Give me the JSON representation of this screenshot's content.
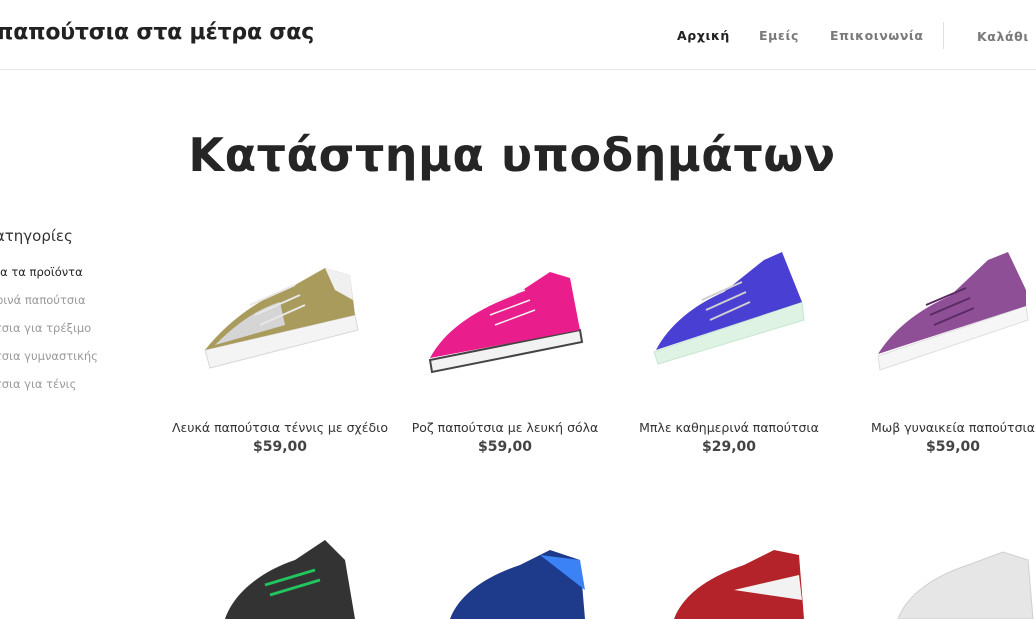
{
  "header": {
    "brand": "παπούτσια στα μέτρα σας",
    "nav": [
      {
        "label": "Αρχική"
      },
      {
        "label": "Εμείς"
      },
      {
        "label": "Επικοινωνία"
      }
    ],
    "cart_label": "Καλάθι"
  },
  "page_title": "Κατάστημα υποδημάτων",
  "sidebar": {
    "heading": "κατηγορίες",
    "items": [
      {
        "label": "Όλα τα προϊόντα"
      },
      {
        "label": "Καθημερινά παπούτσια"
      },
      {
        "label": "Παπούτσια για τρέξιμο"
      },
      {
        "label": "Παπούτσια γυμναστικής"
      },
      {
        "label": "Παπούτσια για τένις"
      }
    ]
  },
  "products": [
    {
      "name": "Λευκά παπούτσια τέννις με σχέδιο",
      "price": "$59,00",
      "color": "#a99b5c"
    },
    {
      "name": "Ροζ παπούτσια με λευκή σόλα",
      "price": "$59,00",
      "color": "#e91e8c"
    },
    {
      "name": "Μπλε καθημερινά παπούτσια",
      "price": "$29,00",
      "color": "#4a3fd3"
    },
    {
      "name": "Μωβ γυναικεία παπούτσια",
      "price": "$59,00",
      "color": "#8e4f96"
    },
    {
      "name": "",
      "price": "",
      "color": "#333333"
    },
    {
      "name": "",
      "price": "",
      "color": "#1e3a8a"
    },
    {
      "name": "",
      "price": "",
      "color": "#b4232a"
    },
    {
      "name": "",
      "price": "",
      "color": "#e6e6e6"
    }
  ]
}
